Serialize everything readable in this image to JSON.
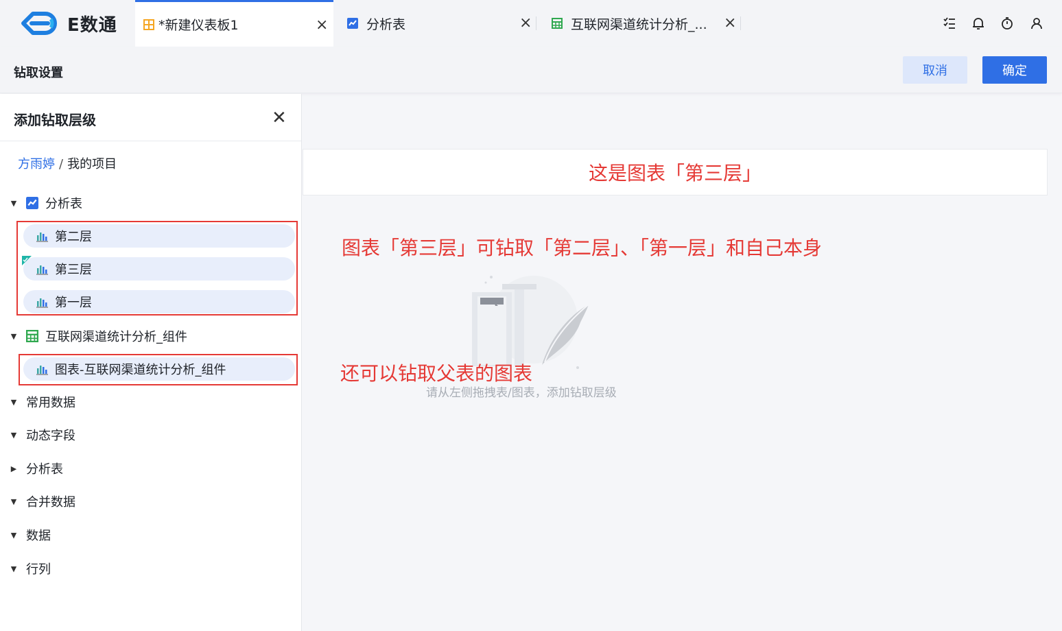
{
  "app": {
    "logo_text": "E数通"
  },
  "tabs": [
    {
      "label": "*新建仪表板1",
      "active": true
    },
    {
      "label": "分析表",
      "active": false
    },
    {
      "label": "互联网渠道统计分析_...",
      "active": false
    }
  ],
  "header": {
    "title": "钻取设置",
    "cancel_label": "取消",
    "ok_label": "确定"
  },
  "panel": {
    "title": "添加钻取层级",
    "breadcrumb": {
      "user": "方雨婷",
      "separator": "/",
      "current": "我的项目"
    },
    "tree": {
      "analysis_table": {
        "label": "分析表",
        "items": [
          "第二层",
          "第三层",
          "第一层"
        ]
      },
      "internet_table": {
        "label": "互联网渠道统计分析_组件",
        "items": [
          "图表-互联网渠道统计分析_组件"
        ]
      },
      "folders": [
        "常用数据",
        "动态字段",
        "分析表",
        "合并数据",
        "数据",
        "行列"
      ]
    }
  },
  "main": {
    "chart_header": "这是图表「第三层」",
    "annotation_1": "图表「第三层」可钻取「第二层」、「第一层」和自己本身",
    "annotation_2": "还可以钻取父表的图表",
    "empty_hint": "请从左侧拖拽表/图表，添加钻取层级"
  },
  "colors": {
    "accent": "#2f6fe5",
    "annotation_red": "#e53935",
    "chart_item_bg": "#e8eefb",
    "sheet_green": "#2fa84f",
    "dashboard_orange": "#f5a623"
  },
  "icons": {
    "dashboard_tab": "dashboard-icon",
    "analysis_tab": "line-chart-icon",
    "sheet_tab": "sheet-icon",
    "toolbar": [
      "task-list-icon",
      "bell-icon",
      "timer-icon",
      "user-icon"
    ]
  }
}
